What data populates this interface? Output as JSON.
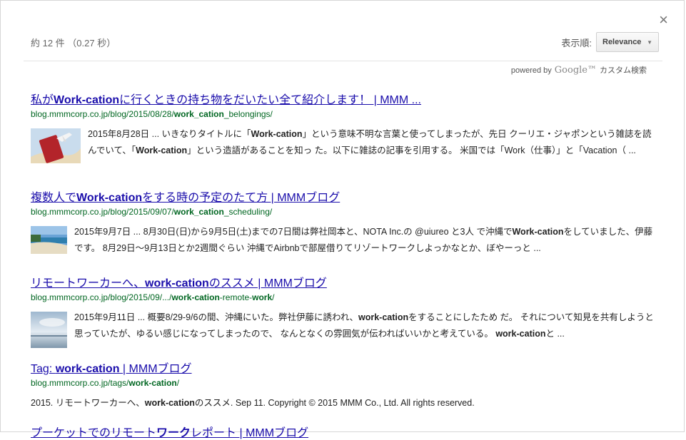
{
  "header": {
    "close_symbol": "×",
    "result_info": "約 12 件 （0.27 秒）",
    "sort_label": "表示順:",
    "sort_value": "Relevance",
    "powered_by": "powered by",
    "google": "Google™",
    "custom_search": "カスタム検索"
  },
  "results": [
    {
      "title": "私が{{Work-cation}}に行くときの持ち物をだいたい全て紹介します！ | MMM ...",
      "url": "blog.mmmcorp.co.jp/blog/2015/08/28/{{work_cation}}_belongings/",
      "thumb": "passport-airplane",
      "snippet": "2015年8月28日 ... いきなりタイトルに「{{Work-cation}}」という意味不明な言葉と使ってしまったが、先日 クーリエ・ジャポンという雑誌を読んでいて、「{{Work-cation}}」という造語があることを知っ た。以下に雑誌の記事を引用する。 米国では「Work（仕事）」と「Vacation（ ..."
    },
    {
      "title": "複数人で{{Work-cation}}をする時の予定のたて方 | MMMブログ",
      "url": "blog.mmmcorp.co.jp/blog/2015/09/07/{{work_cation}}_scheduling/",
      "thumb": "beach",
      "snippet": "2015年9月7日 ... 8月30日(日)から9月5日(土)までの7日間は弊社岡本と、NOTA Inc.の @uiureo と3人 で沖縄で{{Work-cation}}をしていました、伊藤です。 8月29日〜9月13日とか2週間ぐらい 沖縄でAirbnbで部屋借りてリゾートワークしよっかなとか、ぼやーっと ..."
    },
    {
      "title": "リモートワーカーへ、{{work-cation}}のススメ | MMMブログ",
      "url": "blog.mmmcorp.co.jp/blog/2015/09/.../{{work-cation}}-remote-{{work}}/",
      "thumb": "sky",
      "snippet": "2015年9月11日 ... 概要8/29-9/6の間、沖縄にいた。弊社伊藤に誘われ、{{work-cation}}をすることにしたため だ。 それについて知見を共有しようと思っていたが、ゆるい感じになってしまったので、 なんとなくの雰囲気が伝わればいいかと考えている。 {{work-cation}}と ..."
    },
    {
      "title": "Tag: {{work-cation}} | MMMブログ",
      "url": "blog.mmmcorp.co.jp/tags/{{work-cation}}/",
      "thumb": "",
      "snippet": "2015. リモートワーカーへ、{{work-cation}}のススメ. Sep 11. Copyright © 2015 MMM Co., Ltd. All rights reserved."
    },
    {
      "title": "プーケットでのリモート{{ワーク}}レポート | MMMブログ",
      "url": "",
      "thumb": "",
      "snippet": ""
    }
  ]
}
